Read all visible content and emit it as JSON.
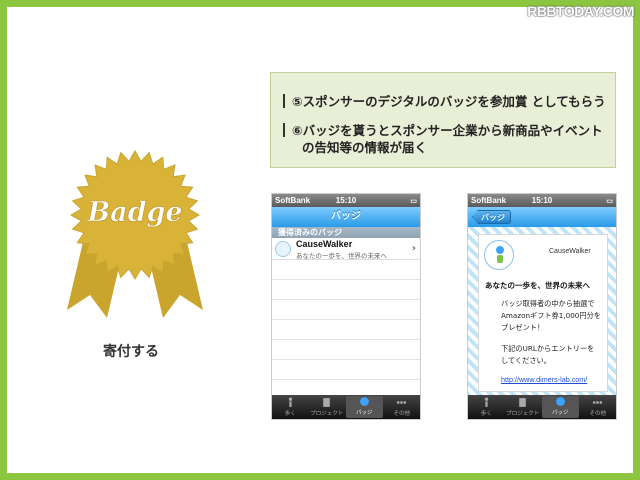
{
  "watermark": "RBBTODAY.COM",
  "badge": {
    "label": "Badge",
    "caption": "寄付する",
    "color": "#d9b338"
  },
  "notes": [
    "⑤スポンサーのデジタルのバッジを参加賞 としてもらう",
    "⑥バッジを貰うとスポンサー企業から新商品やイベント",
    "の告知等の情報が届く"
  ],
  "phone_list": {
    "carrier": "SoftBank",
    "time": "15:10",
    "nav_title": "バッジ",
    "section_header": "獲得済みのバッジ",
    "item": {
      "title": "CauseWalker",
      "subtitle": "あなたの一歩を、世界の未来へ"
    },
    "tabs": [
      {
        "label": "歩く",
        "icon": "walker-icon"
      },
      {
        "label": "プロジェクト",
        "icon": "project-icon"
      },
      {
        "label": "バッジ",
        "icon": "badge-icon"
      },
      {
        "label": "その他",
        "icon": "more-icon"
      }
    ],
    "active_tab": 2
  },
  "phone_detail": {
    "carrier": "SoftBank",
    "time": "15:10",
    "back_label": "バッジ",
    "sponsor": "CauseWalker",
    "headline": "あなたの一歩を、世界の未来へ",
    "body_lines": [
      "バッジ取得者の中から抽選で",
      "Amazonギフト券1,000円分を",
      "プレゼント！"
    ],
    "body2_lines": [
      "下記のURLからエントリーを",
      "してください。"
    ],
    "link": "http://www.dimers-lab.com/",
    "tabs": [
      {
        "label": "歩く",
        "icon": "walker-icon"
      },
      {
        "label": "プロジェクト",
        "icon": "project-icon"
      },
      {
        "label": "バッジ",
        "icon": "badge-icon"
      },
      {
        "label": "その他",
        "icon": "more-icon"
      }
    ],
    "active_tab": 2
  }
}
